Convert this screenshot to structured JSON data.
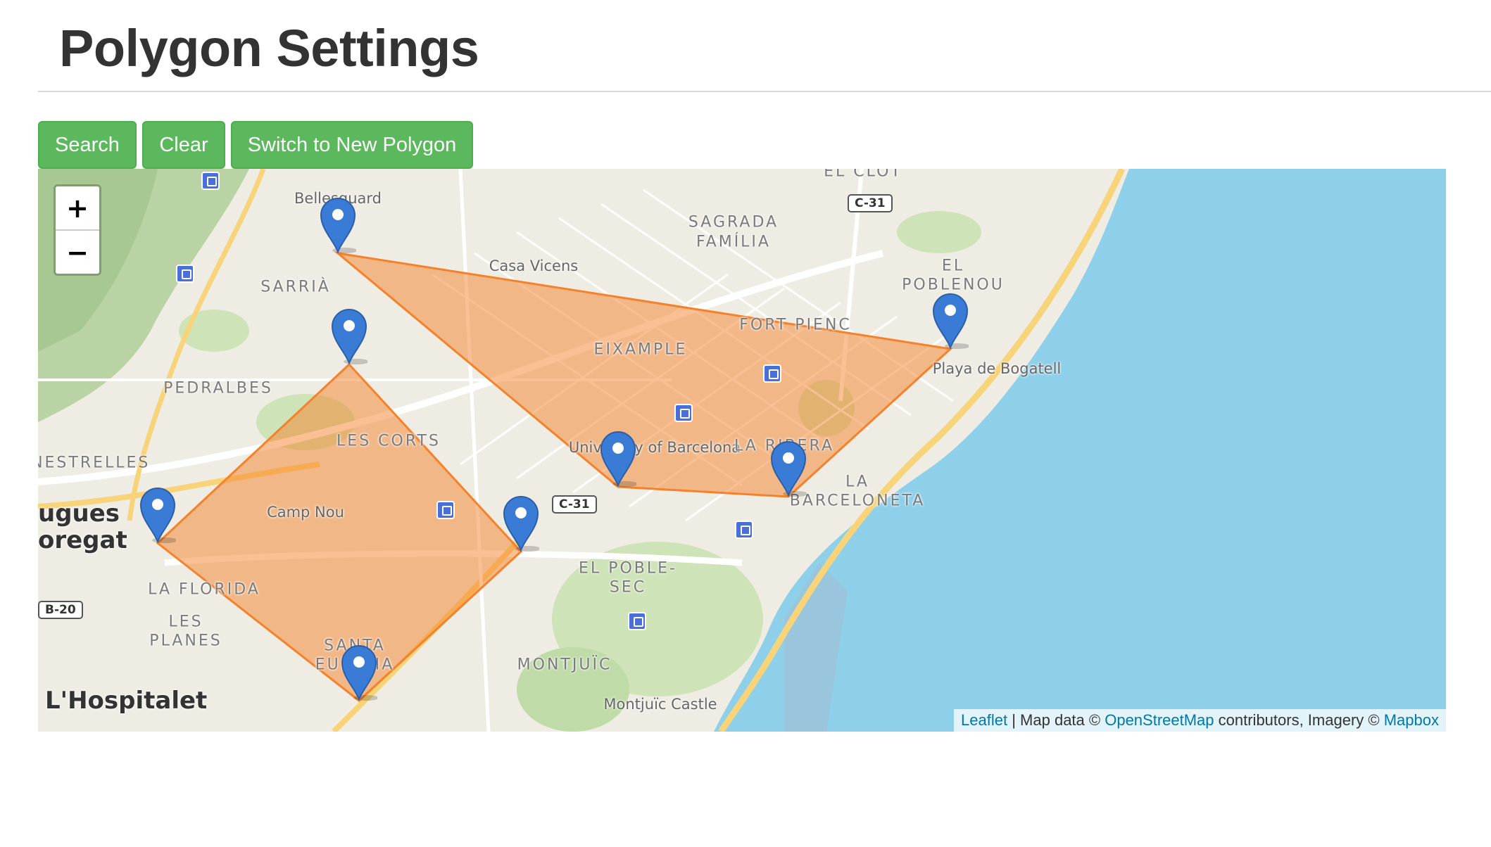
{
  "page": {
    "title": "Polygon Settings"
  },
  "toolbar": {
    "search_label": "Search",
    "clear_label": "Clear",
    "switch_label": "Switch to New Polygon",
    "button_color": "#5cb85c"
  },
  "map": {
    "zoom_in_label": "+",
    "zoom_out_label": "−",
    "polygon_color": "#f5822a",
    "water_color": "#8ecfea",
    "marker_color": "#3a7bd5",
    "labels": {
      "bellesguard": "Bellesguard",
      "sarria": "SARRIÀ",
      "pedralbes": "PEDRALBES",
      "les_corts": "LES CORTS",
      "camp_nou": "Camp Nou",
      "casa_vicens": "Casa Vicens",
      "sagrada_familia_1": "SAGRADA",
      "sagrada_familia_2": "FAMÍLIA",
      "el_clot": "EL CLOT",
      "el_poblenou_1": "EL",
      "el_poblenou_2": "POBLENOU",
      "fort_pienc": "FORT PIENC",
      "eixample": "EIXAMPLE",
      "playa_bogatell": "Playa de Bogatell",
      "university": "University of Barcelona",
      "la_ribera": "LA RIBERA",
      "la_barceloneta_1": "LA",
      "la_barceloneta_2": "BARCELONETA",
      "esplugues_1": "ugues",
      "esplugues_2": "oregat",
      "finestrelles": "INESTRELLES",
      "la_florida": "LA FLORIDA",
      "les_planes_1": "LES",
      "les_planes_2": "PLANES",
      "el_poble_sec_1": "EL POBLE-",
      "el_poble_sec_2": "SEC",
      "montjuic": "MONTJUÏC",
      "montjuic_castle": "Montjuïc Castle",
      "hospitalet": "L'Hospitalet",
      "santa_eulalia_1": "SANTA",
      "santa_eulalia_2": "EULÀLIA",
      "road_c31_a": "C-31",
      "road_c31_b": "C-31",
      "road_b20": "B-20"
    },
    "markers": [
      {
        "name": "marker-bellesguard"
      },
      {
        "name": "marker-sarria"
      },
      {
        "name": "marker-poblenou"
      },
      {
        "name": "marker-university"
      },
      {
        "name": "marker-ribera"
      },
      {
        "name": "marker-esplugues"
      },
      {
        "name": "marker-poble-sec"
      },
      {
        "name": "marker-santa-eulalia"
      }
    ],
    "attribution": {
      "leaflet": "Leaflet",
      "sep1": " | Map data © ",
      "osm": "OpenStreetMap",
      "sep2": " contributors, Imagery © ",
      "mapbox": "Mapbox"
    }
  }
}
